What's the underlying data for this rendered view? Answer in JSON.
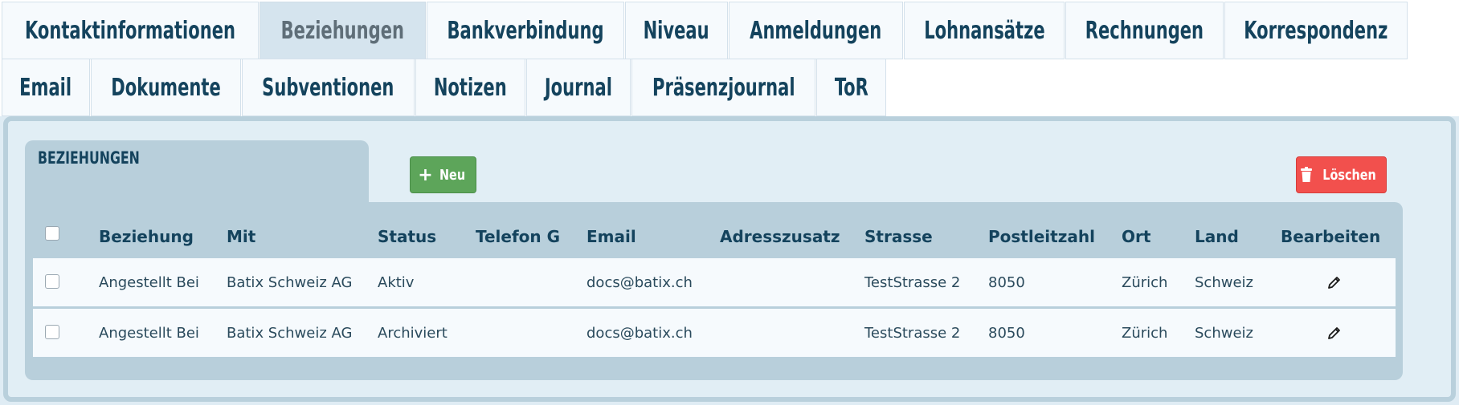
{
  "tabs": {
    "row1": [
      {
        "label": "Kontaktinformationen",
        "active": false
      },
      {
        "label": "Beziehungen",
        "active": true
      },
      {
        "label": "Bankverbindung",
        "active": false
      },
      {
        "label": "Niveau",
        "active": false
      },
      {
        "label": "Anmeldungen",
        "active": false
      },
      {
        "label": "Lohnansätze",
        "active": false
      },
      {
        "label": "Rechnungen",
        "active": false
      },
      {
        "label": "Korrespondenz",
        "active": false
      }
    ],
    "row2": [
      {
        "label": "Email",
        "active": false
      },
      {
        "label": "Dokumente",
        "active": false
      },
      {
        "label": "Subventionen",
        "active": false
      },
      {
        "label": "Notizen",
        "active": false
      },
      {
        "label": "Journal",
        "active": false
      },
      {
        "label": "Präsenzjournal",
        "active": false
      },
      {
        "label": "ToR",
        "active": false
      }
    ]
  },
  "section": {
    "title": "BEZIEHUNGEN",
    "new_label": "Neu",
    "delete_label": "Löschen"
  },
  "table": {
    "headers": [
      "Beziehung",
      "Mit",
      "Status",
      "Telefon G",
      "Email",
      "Adresszusatz",
      "Strasse",
      "Postleitzahl",
      "Ort",
      "Land",
      "Bearbeiten"
    ],
    "rows": [
      [
        "Angestellt Bei",
        "Batix Schweiz AG",
        "Aktiv",
        "",
        "docs@batix.ch",
        "",
        "TestStrasse 2",
        "8050",
        "Zürich",
        "Schweiz"
      ],
      [
        "Angestellt Bei",
        "Batix Schweiz AG",
        "Archiviert",
        "",
        "docs@batix.ch",
        "",
        "TestStrasse 2",
        "8050",
        "Zürich",
        "Schweiz"
      ]
    ]
  },
  "colors": {
    "accent": "#14435d",
    "new_button": "#5da55a",
    "delete_button": "#f2504d"
  }
}
